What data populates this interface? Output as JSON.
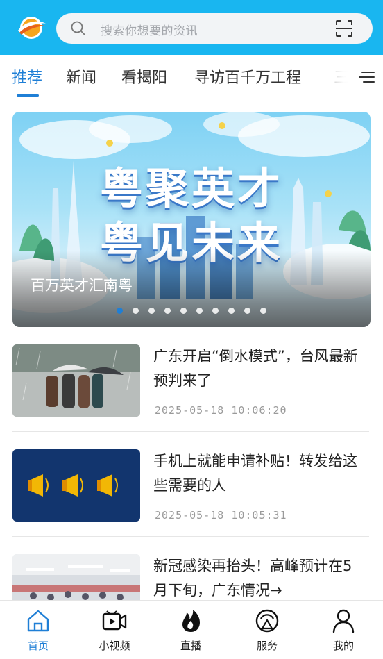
{
  "header": {
    "search_placeholder": "搜索你想要的资讯",
    "logo_icon": "app-logo",
    "search_icon": "search-icon",
    "scan_icon": "scan-icon",
    "background_color": "#19b6f0"
  },
  "tabs": {
    "items": [
      {
        "label": "推荐",
        "active": true
      },
      {
        "label": "新闻",
        "active": false
      },
      {
        "label": "看揭阳",
        "active": false
      },
      {
        "label": "寻访百千万工程",
        "active": false
      },
      {
        "label": "三",
        "active": false
      }
    ],
    "menu_icon": "menu-icon",
    "accent_color": "#1f7fd6"
  },
  "banner": {
    "headline_line1": "粤聚英才",
    "headline_line2": "粤见未来",
    "caption": "百万英才汇南粤",
    "slide_count": 10,
    "active_slide": 1
  },
  "news": [
    {
      "title": "广东开启“倒水模式”，台风最新预判来了",
      "time": "2025-05-18  10:06:20",
      "thumb": "people-with-umbrellas-in-rain"
    },
    {
      "title": "手机上就能申请补贴！转发给这些需要的人",
      "time": "2025-05-18  10:05:31",
      "thumb": "megaphone-icons"
    },
    {
      "title": "新冠感染再抬头！高峰预计在5月下旬，广东情况→",
      "time": "",
      "thumb": "hospital-hall"
    }
  ],
  "bottom_nav": {
    "items": [
      {
        "label": "首页",
        "icon": "home-icon",
        "active": true
      },
      {
        "label": "小视频",
        "icon": "video-icon",
        "active": false
      },
      {
        "label": "直播",
        "icon": "live-fire-icon",
        "active": false
      },
      {
        "label": "服务",
        "icon": "service-icon",
        "active": false
      },
      {
        "label": "我的",
        "icon": "profile-icon",
        "active": false
      }
    ]
  }
}
